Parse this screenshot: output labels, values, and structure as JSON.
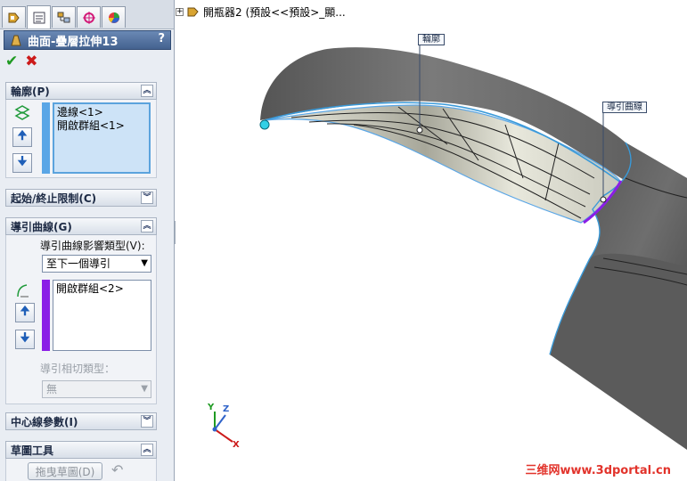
{
  "pm": {
    "tabs": [
      {
        "icon": "feature-manager-icon"
      },
      {
        "icon": "property-manager-icon"
      },
      {
        "icon": "configuration-manager-icon"
      },
      {
        "icon": "dimxpert-icon"
      },
      {
        "icon": "display-manager-icon"
      }
    ],
    "title": "曲面-疊層拉伸13",
    "help": "?",
    "ok": "✔",
    "cancel": "✖",
    "profile": {
      "header": "輪廓(P)",
      "items": [
        "邊線<1>",
        "開啟群組<1>"
      ]
    },
    "start_end": {
      "header": "起始/終止限制(C)"
    },
    "guides": {
      "header": "導引曲線(G)",
      "influence_label": "導引曲線影響類型(V):",
      "influence_value": "至下一個導引",
      "items": [
        "開啟群組<2>"
      ],
      "tangency_label": "導引相切類型：",
      "tangency_value": "無"
    },
    "centerline": {
      "header": "中心線參數(I)"
    },
    "sketch_tools": {
      "header": "草圖工具",
      "drag_button": "拖曳草圖(D)"
    }
  },
  "graphics": {
    "tree_flyout": "開瓶器2  (預設<<預設>_顯...",
    "callouts": {
      "profile": "輪廓",
      "guide": "導引曲線"
    },
    "triad": {
      "x": "X",
      "y": "Y",
      "z": "Z"
    },
    "watermark": "三维网www.3dportal.cn"
  },
  "colors": {
    "accent_blue": "#3a9ad9",
    "guide_purple": "#8b1ee6",
    "profile_blue": "#5aa6e6"
  }
}
